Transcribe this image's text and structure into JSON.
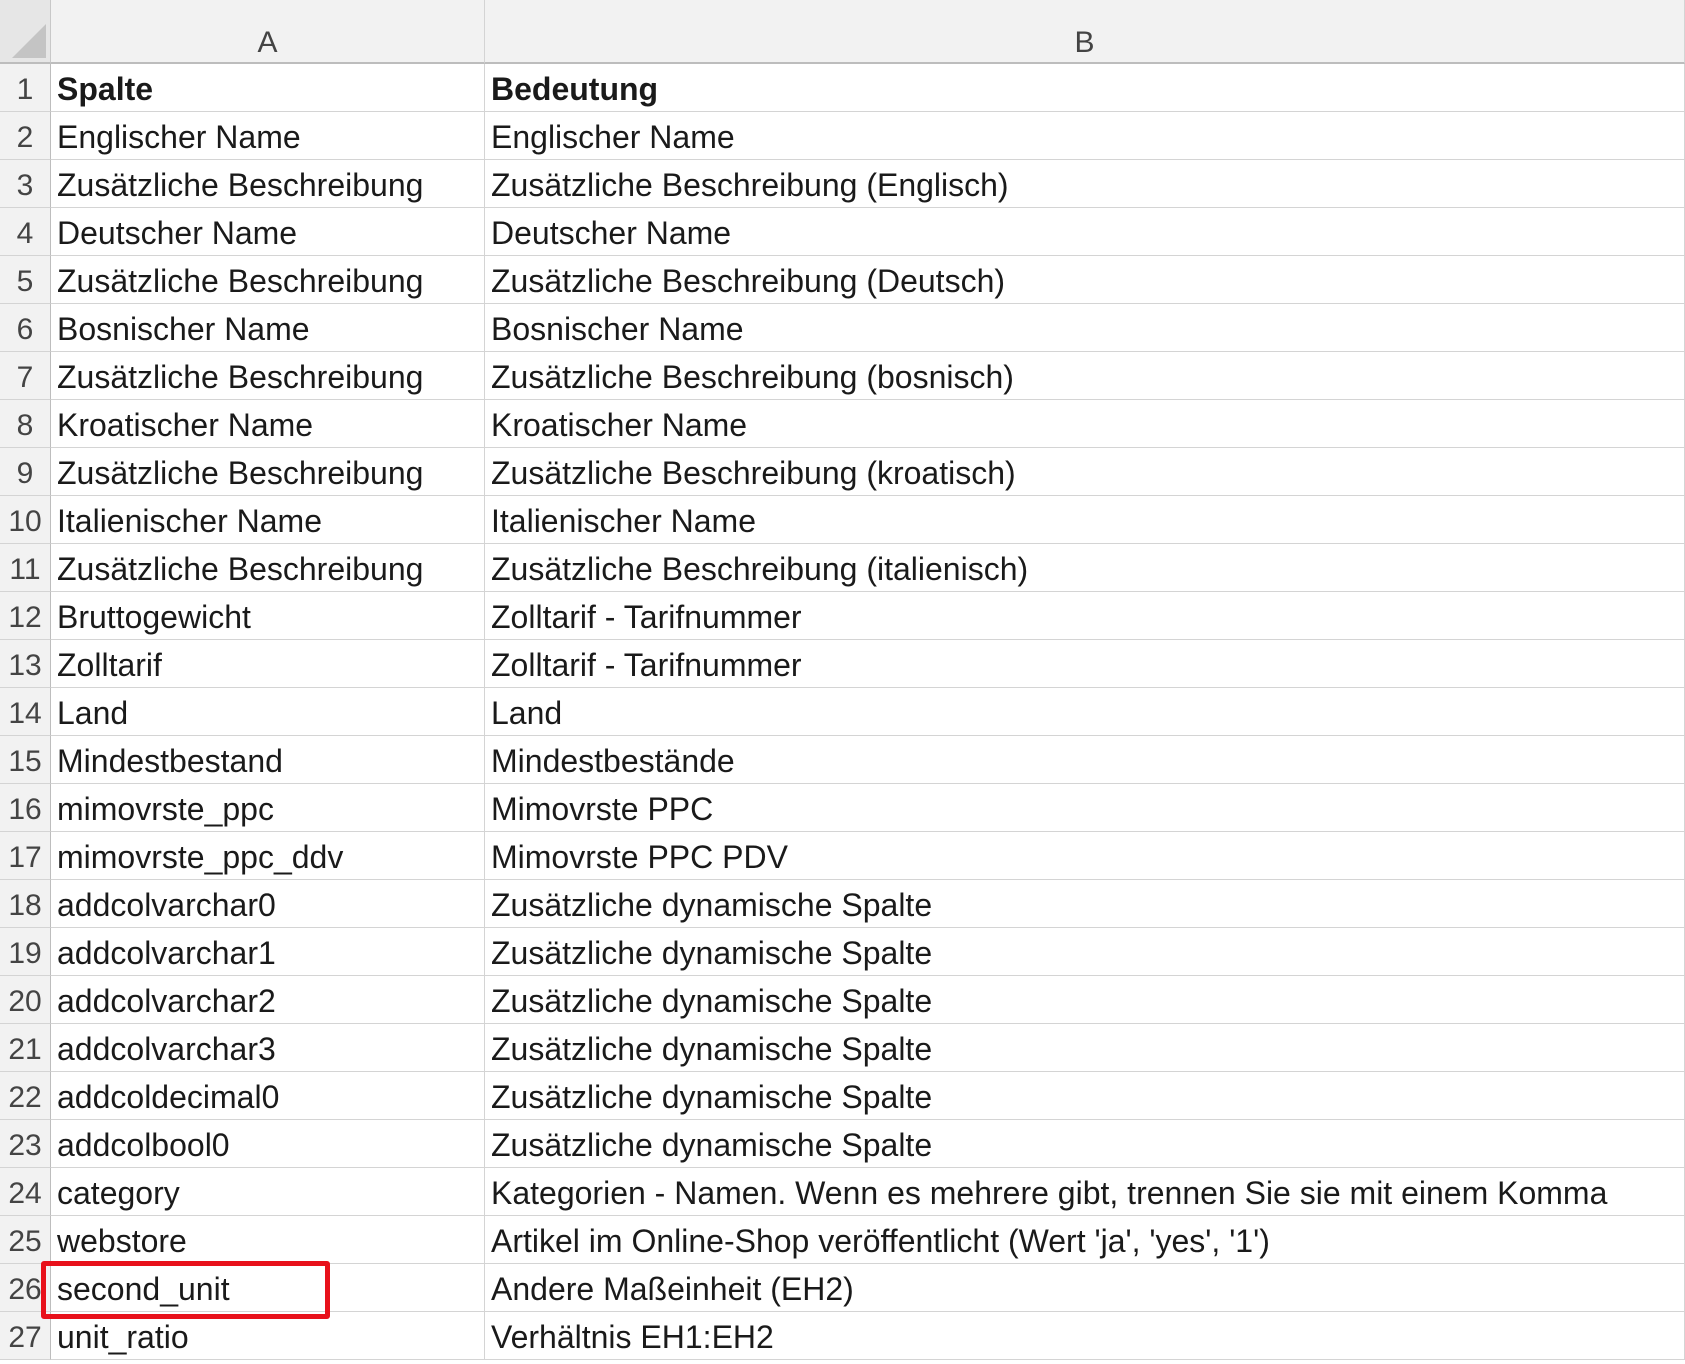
{
  "columns": {
    "a": "A",
    "b": "B"
  },
  "rows": [
    {
      "num": "1",
      "a": "Spalte",
      "b": "Bedeutung"
    },
    {
      "num": "2",
      "a": "Englischer Name",
      "b": "Englischer Name"
    },
    {
      "num": "3",
      "a": "Zusätzliche Beschreibung",
      "b": "Zusätzliche Beschreibung (Englisch)"
    },
    {
      "num": "4",
      "a": "Deutscher Name",
      "b": "Deutscher Name"
    },
    {
      "num": "5",
      "a": "Zusätzliche Beschreibung",
      "b": "Zusätzliche Beschreibung (Deutsch)"
    },
    {
      "num": "6",
      "a": "Bosnischer Name",
      "b": "Bosnischer Name"
    },
    {
      "num": "7",
      "a": "Zusätzliche Beschreibung",
      "b": "Zusätzliche Beschreibung (bosnisch)"
    },
    {
      "num": "8",
      "a": "Kroatischer Name",
      "b": "Kroatischer Name"
    },
    {
      "num": "9",
      "a": "Zusätzliche Beschreibung",
      "b": "Zusätzliche Beschreibung (kroatisch)"
    },
    {
      "num": "10",
      "a": "Italienischer Name",
      "b": "Italienischer Name"
    },
    {
      "num": "11",
      "a": "Zusätzliche Beschreibung",
      "b": "Zusätzliche Beschreibung (italienisch)"
    },
    {
      "num": "12",
      "a": "Bruttogewicht",
      "b": "Zolltarif - Tarifnummer"
    },
    {
      "num": "13",
      "a": "Zolltarif",
      "b": "Zolltarif - Tarifnummer"
    },
    {
      "num": "14",
      "a": "Land",
      "b": "Land"
    },
    {
      "num": "15",
      "a": "Mindestbestand",
      "b": "Mindestbestände"
    },
    {
      "num": "16",
      "a": "mimovrste_ppc",
      "b": "Mimovrste PPC"
    },
    {
      "num": "17",
      "a": "mimovrste_ppc_ddv",
      "b": "Mimovrste PPC PDV"
    },
    {
      "num": "18",
      "a": "addcolvarchar0",
      "b": "Zusätzliche dynamische Spalte"
    },
    {
      "num": "19",
      "a": "addcolvarchar1",
      "b": "Zusätzliche dynamische Spalte"
    },
    {
      "num": "20",
      "a": "addcolvarchar2",
      "b": "Zusätzliche dynamische Spalte"
    },
    {
      "num": "21",
      "a": "addcolvarchar3",
      "b": "Zusätzliche dynamische Spalte"
    },
    {
      "num": "22",
      "a": "addcoldecimal0",
      "b": "Zusätzliche dynamische Spalte"
    },
    {
      "num": "23",
      "a": "addcolbool0",
      "b": "Zusätzliche dynamische Spalte"
    },
    {
      "num": "24",
      "a": "category",
      "b": "Kategorien - Namen. Wenn es mehrere gibt, trennen Sie sie mit einem Komma"
    },
    {
      "num": "25",
      "a": "webstore",
      "b": "Artikel im Online-Shop veröffentlicht (Wert 'ja', 'yes', '1')"
    },
    {
      "num": "26",
      "a": "second_unit",
      "b": "Andere Maßeinheit (EH2)"
    },
    {
      "num": "27",
      "a": "unit_ratio",
      "b": "Verhältnis EH1:EH2"
    }
  ],
  "highlight_color": "#e8111b",
  "highlighted_row": "26"
}
